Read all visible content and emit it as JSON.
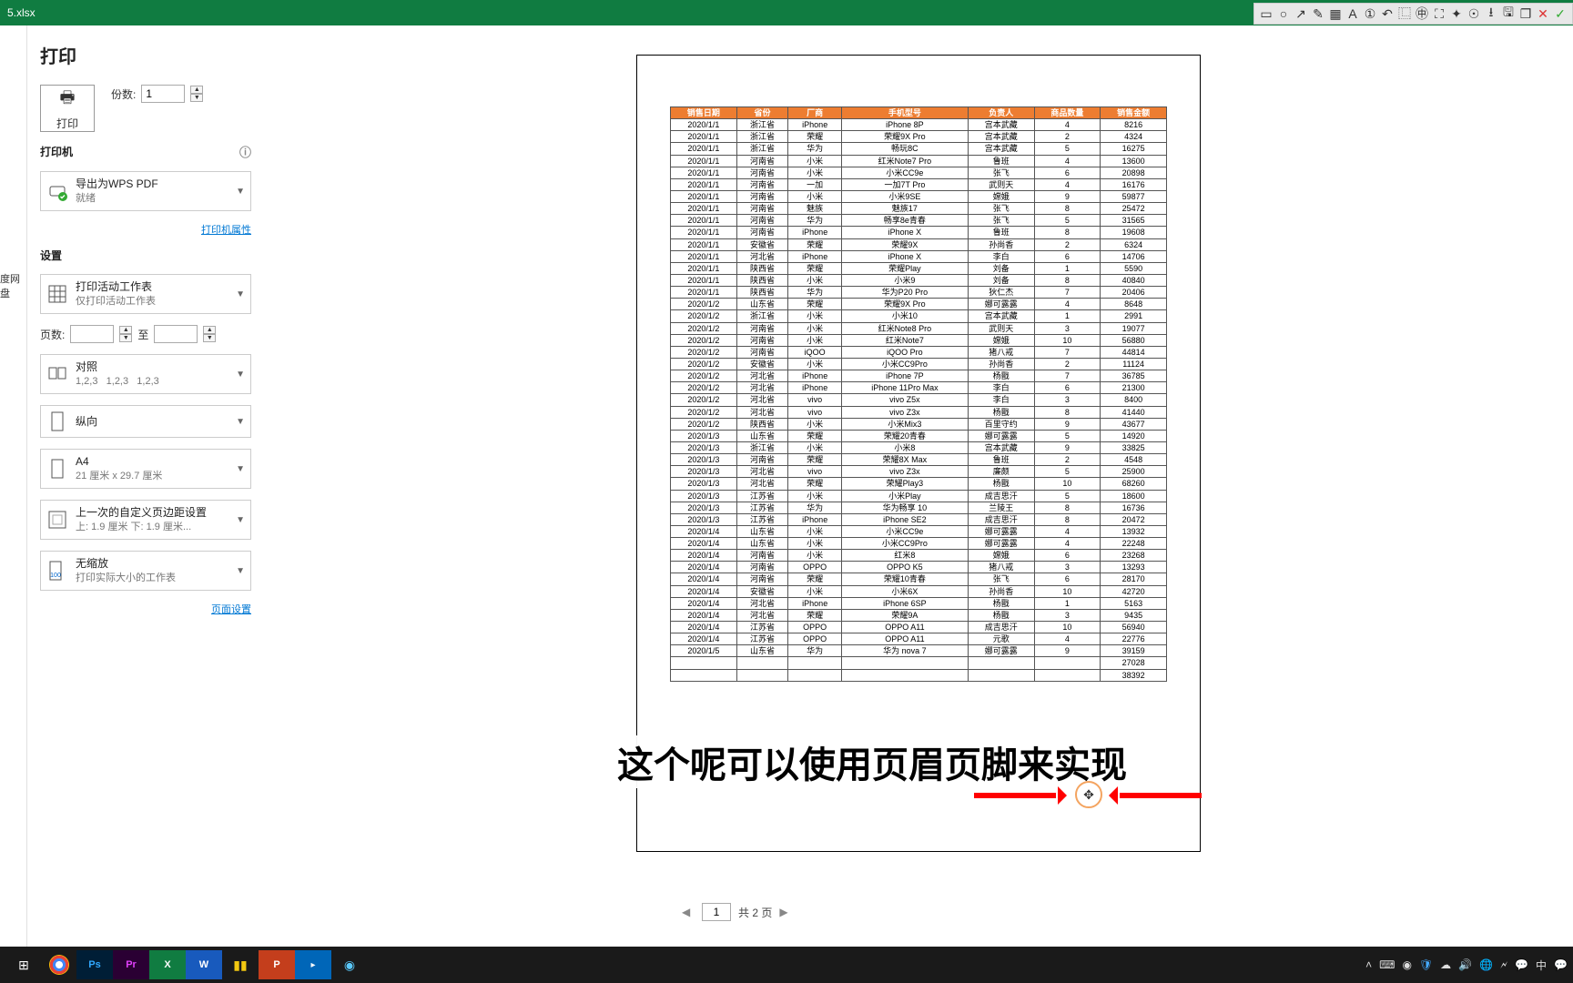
{
  "titlebar": {
    "filename": "5.xlsx"
  },
  "print": {
    "title": "打印",
    "button_label": "打印",
    "copies_label": "份数:",
    "copies_value": "1"
  },
  "printer": {
    "head": "打印机",
    "name": "导出为WPS PDF",
    "status": "就绪",
    "props_link": "打印机属性"
  },
  "settings": {
    "head": "设置",
    "scope_l1": "打印活动工作表",
    "scope_l2": "仅打印活动工作表",
    "pages_label": "页数:",
    "pages_to": "至",
    "collate_l1": "对照",
    "collate_l2a": "1,2,3",
    "collate_l2b": "1,2,3",
    "collate_l2c": "1,2,3",
    "orient": "纵向",
    "size_l1": "A4",
    "size_l2": "21 厘米 x 29.7 厘米",
    "margin_l1": "上一次的自定义页边距设置",
    "margin_l2": "上: 1.9 厘米 下: 1.9 厘米...",
    "scale_l1": "无缩放",
    "scale_l2": "打印实际大小的工作表",
    "page_setup_link": "页面设置"
  },
  "leftedge": {
    "label": "度网盘"
  },
  "pager": {
    "current": "1",
    "total_label": "共 2 页"
  },
  "annotation": {
    "text": "这个呢可以使用页眉页脚来实现"
  },
  "table": {
    "headers": [
      "销售日期",
      "省份",
      "厂商",
      "手机型号",
      "负责人",
      "商品数量",
      "销售金额"
    ],
    "rows": [
      [
        "2020/1/1",
        "浙江省",
        "iPhone",
        "iPhone 8P",
        "宫本武藏",
        "4",
        "8216"
      ],
      [
        "2020/1/1",
        "浙江省",
        "荣耀",
        "荣耀9X Pro",
        "宫本武藏",
        "2",
        "4324"
      ],
      [
        "2020/1/1",
        "浙江省",
        "华为",
        "畅玩8C",
        "宫本武藏",
        "5",
        "16275"
      ],
      [
        "2020/1/1",
        "河南省",
        "小米",
        "红米Note7 Pro",
        "鲁班",
        "4",
        "13600"
      ],
      [
        "2020/1/1",
        "河南省",
        "小米",
        "小米CC9e",
        "张飞",
        "6",
        "20898"
      ],
      [
        "2020/1/1",
        "河南省",
        "一加",
        "一加7T Pro",
        "武则天",
        "4",
        "16176"
      ],
      [
        "2020/1/1",
        "河南省",
        "小米",
        "小米9SE",
        "嫦娥",
        "9",
        "59877"
      ],
      [
        "2020/1/1",
        "河南省",
        "魅族",
        "魅族17",
        "张飞",
        "8",
        "25472"
      ],
      [
        "2020/1/1",
        "河南省",
        "华为",
        "畅享8e青春",
        "张飞",
        "5",
        "31565"
      ],
      [
        "2020/1/1",
        "河南省",
        "iPhone",
        "iPhone X",
        "鲁班",
        "8",
        "19608"
      ],
      [
        "2020/1/1",
        "安徽省",
        "荣耀",
        "荣耀9X",
        "孙尚香",
        "2",
        "6324"
      ],
      [
        "2020/1/1",
        "河北省",
        "iPhone",
        "iPhone X",
        "李白",
        "6",
        "14706"
      ],
      [
        "2020/1/1",
        "陕西省",
        "荣耀",
        "荣耀Play",
        "刘备",
        "1",
        "5590"
      ],
      [
        "2020/1/1",
        "陕西省",
        "小米",
        "小米9",
        "刘备",
        "8",
        "40840"
      ],
      [
        "2020/1/1",
        "陕西省",
        "华为",
        "华为P20 Pro",
        "狄仁杰",
        "7",
        "20406"
      ],
      [
        "2020/1/2",
        "山东省",
        "荣耀",
        "荣耀9X Pro",
        "娜可露露",
        "4",
        "8648"
      ],
      [
        "2020/1/2",
        "浙江省",
        "小米",
        "小米10",
        "宫本武藏",
        "1",
        "2991"
      ],
      [
        "2020/1/2",
        "河南省",
        "小米",
        "红米Note8 Pro",
        "武则天",
        "3",
        "19077"
      ],
      [
        "2020/1/2",
        "河南省",
        "小米",
        "红米Note7",
        "嫦娥",
        "10",
        "56880"
      ],
      [
        "2020/1/2",
        "河南省",
        "iQOO",
        "iQOO Pro",
        "猪八戒",
        "7",
        "44814"
      ],
      [
        "2020/1/2",
        "安徽省",
        "小米",
        "小米CC9Pro",
        "孙尚香",
        "2",
        "11124"
      ],
      [
        "2020/1/2",
        "河北省",
        "iPhone",
        "iPhone 7P",
        "杨戬",
        "7",
        "36785"
      ],
      [
        "2020/1/2",
        "河北省",
        "iPhone",
        "iPhone 11Pro Max",
        "李白",
        "6",
        "21300"
      ],
      [
        "2020/1/2",
        "河北省",
        "vivo",
        "vivo Z5x",
        "李白",
        "3",
        "8400"
      ],
      [
        "2020/1/2",
        "河北省",
        "vivo",
        "vivo Z3x",
        "杨戬",
        "8",
        "41440"
      ],
      [
        "2020/1/2",
        "陕西省",
        "小米",
        "小米Mix3",
        "百里守约",
        "9",
        "43677"
      ],
      [
        "2020/1/3",
        "山东省",
        "荣耀",
        "荣耀20青春",
        "娜可露露",
        "5",
        "14920"
      ],
      [
        "2020/1/3",
        "浙江省",
        "小米",
        "小米8",
        "宫本武藏",
        "9",
        "33825"
      ],
      [
        "2020/1/3",
        "河南省",
        "荣耀",
        "荣耀8X Max",
        "鲁班",
        "2",
        "4548"
      ],
      [
        "2020/1/3",
        "河北省",
        "vivo",
        "vivo Z3x",
        "廉颇",
        "5",
        "25900"
      ],
      [
        "2020/1/3",
        "河北省",
        "荣耀",
        "荣耀Play3",
        "杨戬",
        "10",
        "68260"
      ],
      [
        "2020/1/3",
        "江苏省",
        "小米",
        "小米Play",
        "成吉思汗",
        "5",
        "18600"
      ],
      [
        "2020/1/3",
        "江苏省",
        "华为",
        "华为畅享 10",
        "兰陵王",
        "8",
        "16736"
      ],
      [
        "2020/1/3",
        "江苏省",
        "iPhone",
        "iPhone SE2",
        "成吉思汗",
        "8",
        "20472"
      ],
      [
        "2020/1/4",
        "山东省",
        "小米",
        "小米CC9e",
        "娜可露露",
        "4",
        "13932"
      ],
      [
        "2020/1/4",
        "山东省",
        "小米",
        "小米CC9Pro",
        "娜可露露",
        "4",
        "22248"
      ],
      [
        "2020/1/4",
        "河南省",
        "小米",
        "红米8",
        "嫦娥",
        "6",
        "23268"
      ],
      [
        "2020/1/4",
        "河南省",
        "OPPO",
        "OPPO K5",
        "猪八戒",
        "3",
        "13293"
      ],
      [
        "2020/1/4",
        "河南省",
        "荣耀",
        "荣耀10青春",
        "张飞",
        "6",
        "28170"
      ],
      [
        "2020/1/4",
        "安徽省",
        "小米",
        "小米6X",
        "孙尚香",
        "10",
        "42720"
      ],
      [
        "2020/1/4",
        "河北省",
        "iPhone",
        "iPhone 6SP",
        "杨戬",
        "1",
        "5163"
      ],
      [
        "2020/1/4",
        "河北省",
        "荣耀",
        "荣耀9A",
        "杨戬",
        "3",
        "9435"
      ],
      [
        "2020/1/4",
        "江苏省",
        "OPPO",
        "OPPO A11",
        "成吉思汗",
        "10",
        "56940"
      ],
      [
        "2020/1/4",
        "江苏省",
        "OPPO",
        "OPPO A11",
        "元歌",
        "4",
        "22776"
      ],
      [
        "2020/1/5",
        "山东省",
        "华为",
        "华为 nova 7",
        "娜可露露",
        "9",
        "39159"
      ],
      [
        "",
        "",
        "",
        "",
        "",
        "",
        "27028"
      ],
      [
        "",
        "",
        "",
        "",
        "",
        "",
        "38392"
      ]
    ]
  },
  "taskbar": {
    "tray_ime": "中"
  },
  "colors": {
    "current": "#ff6b35",
    "grid": [
      "#000000",
      "#808080",
      "#800000",
      "#808000",
      "#008000",
      "#008080",
      "#000080",
      "#800080",
      "#ffffff",
      "#c0c0c0",
      "#ff0000",
      "#ffff00",
      "#00ff00",
      "#00ffff",
      "#0000ff",
      "#ff00ff"
    ]
  }
}
